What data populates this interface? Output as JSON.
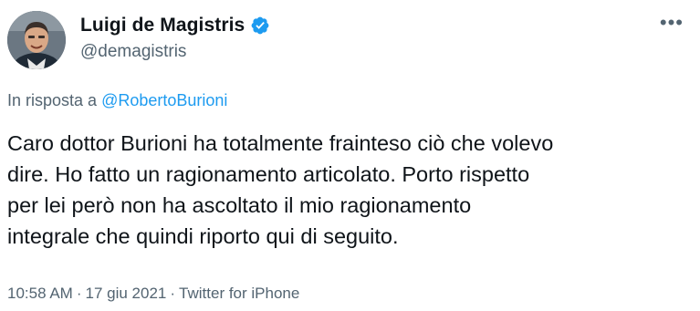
{
  "author": {
    "display_name": "Luigi de Magistris",
    "handle": "@demagistris",
    "verified": true
  },
  "reply": {
    "prefix": "In risposta a ",
    "mention": "@RobertoBurioni"
  },
  "tweet": {
    "text": "Caro dottor Burioni ha totalmente frainteso ciò che volevo\ndire. Ho fatto un ragionamento articolato. Porto rispetto\nper lei però non ha ascoltato il mio ragionamento\nintegrale che quindi riporto qui di seguito."
  },
  "meta": {
    "time": "10:58 AM",
    "separator": "·",
    "date": "17 giu 2021",
    "source": "Twitter for iPhone"
  },
  "icons": {
    "more": "more-dots-icon",
    "verified": "verified-badge-icon"
  },
  "colors": {
    "text": "#0f1419",
    "secondary": "#536471",
    "link": "#1d9bf0",
    "verified": "#1d9bf0"
  }
}
